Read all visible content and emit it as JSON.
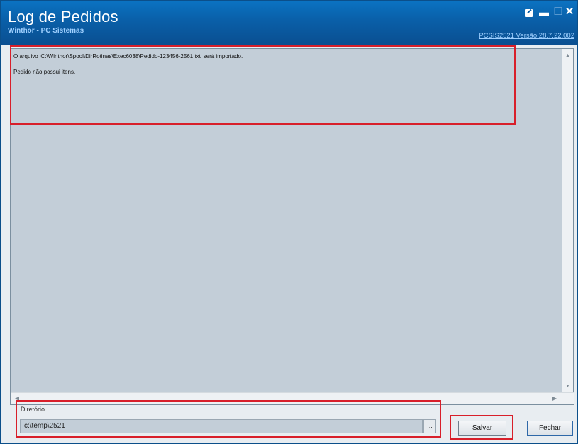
{
  "window": {
    "title": "Log de Pedidos",
    "subtitle": "Winthor - PC Sistemas",
    "version": "PCSIS2521  Versão 28.7.22.002"
  },
  "log": {
    "line1": "O arquivo 'C:\\Winthor\\Spool\\DirRotinas\\Exec6038\\Pedido-123456-2561.txt' será importado.",
    "line2": "Pedido  não possui itens."
  },
  "directory": {
    "label": "Diretório",
    "value": "c:\\temp\\2521",
    "browse": "..."
  },
  "buttons": {
    "salvar": "Salvar",
    "fechar": "Fechar"
  },
  "icons": [
    "edit-icon",
    "minimize-icon",
    "maximize-icon",
    "close-icon"
  ],
  "colors": {
    "titlebar": "#0a5fa8",
    "highlight": "#d81f2a"
  }
}
